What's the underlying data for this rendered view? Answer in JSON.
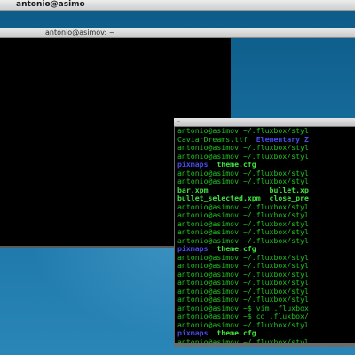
{
  "top_bar": {
    "title": "antonio@asimo"
  },
  "window_a": {
    "title": "antonio@asimov: ~"
  },
  "window_b": {
    "control_glyph": "–"
  },
  "terminal_lines": [
    {
      "a": "antonio@asimov:~/.fluxbox/styl",
      "b": "",
      "style": "normal"
    },
    {
      "a": "CaviarDreams.ttf  ",
      "b": "Elementary Z",
      "style": "file-dir"
    },
    {
      "a": "antonio@asimov:~/.fluxbox/styl",
      "b": "",
      "style": "normal"
    },
    {
      "a": "antonio@asimov:~/.fluxbox/styl",
      "b": "",
      "style": "normal"
    },
    {
      "a": "pixmaps",
      "b": "  theme.cfg",
      "style": "dir-file"
    },
    {
      "a": "antonio@asimov:~/.fluxbox/styl",
      "b": "",
      "style": "normal"
    },
    {
      "a": "antonio@asimov:~/.fluxbox/styl",
      "b": "",
      "style": "normal"
    },
    {
      "a": "bar.xpm",
      "b": "              bullet.xp",
      "style": "bright"
    },
    {
      "a": "bullet_selected.xpm  close_pre",
      "b": "",
      "style": "bright"
    },
    {
      "a": "antonio@asimov:~/.fluxbox/styl",
      "b": "",
      "style": "normal"
    },
    {
      "a": "antonio@asimov:~/.fluxbox/styl",
      "b": "",
      "style": "normal"
    },
    {
      "a": "antonio@asimov:~/.fluxbox/styl",
      "b": "",
      "style": "normal"
    },
    {
      "a": "antonio@asimov:~/.fluxbox/styl",
      "b": "",
      "style": "normal"
    },
    {
      "a": "antonio@asimov:~/.fluxbox/styl",
      "b": "",
      "style": "normal"
    },
    {
      "a": "pixmaps",
      "b": "  theme.cfg",
      "style": "dir-file"
    },
    {
      "a": "antonio@asimov:~/.fluxbox/styl",
      "b": "",
      "style": "normal"
    },
    {
      "a": "antonio@asimov:~/.fluxbox/styl",
      "b": "",
      "style": "normal"
    },
    {
      "a": "antonio@asimov:~/.fluxbox/styl",
      "b": "",
      "style": "normal"
    },
    {
      "a": "antonio@asimov:~/.fluxbox/styl",
      "b": "",
      "style": "normal"
    },
    {
      "a": "antonio@asimov:~/.fluxbox/styl",
      "b": "",
      "style": "normal"
    },
    {
      "a": "antonio@asimov:~/.fluxbox/styl",
      "b": "",
      "style": "normal"
    },
    {
      "a": "antonio@asimov:~$ vim .fluxbox",
      "b": "",
      "style": "normal"
    },
    {
      "a": "antonio@asimov:~$ cd .fluxbox/",
      "b": "",
      "style": "normal"
    },
    {
      "a": "antonio@asimov:~/.fluxbox/styl",
      "b": "",
      "style": "normal"
    },
    {
      "a": "pixmaps",
      "b": "  theme.cfg",
      "style": "dir-file"
    },
    {
      "a": "antonio@asimov:~/.fluxbox/styl",
      "b": "",
      "style": "normal"
    }
  ]
}
